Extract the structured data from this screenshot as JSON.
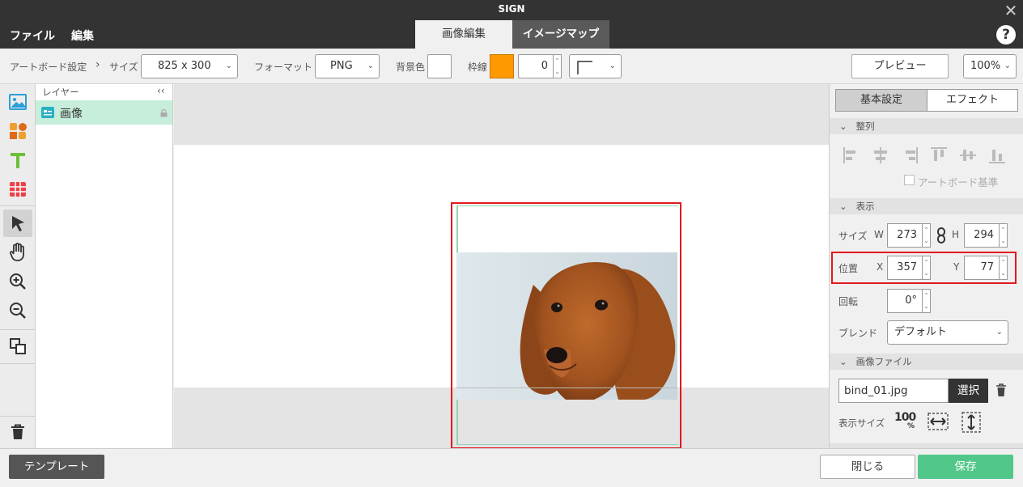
{
  "app": {
    "title": "SIGN",
    "close_glyph": "✕"
  },
  "menu": {
    "file": "ファイル",
    "edit": "編集"
  },
  "tabs": {
    "image_edit": "画像編集",
    "image_map": "イメージマップ"
  },
  "help_glyph": "?",
  "toolbar": {
    "artboard_settings": "アートボード設定",
    "arrow": "›",
    "size_label": "サイズ",
    "size_value": "825 x 300",
    "format_label": "フォーマット",
    "format_value": "PNG",
    "bg_color_label": "背景色",
    "bg_color": "#ffffff",
    "border_label": "枠線",
    "border_color": "#ff9900",
    "border_width": "0",
    "preview_button": "プレビュー",
    "zoom_value": "100%"
  },
  "layers": {
    "header": "レイヤー",
    "collapse_glyph": "‹‹",
    "items": [
      {
        "label": "画像"
      }
    ]
  },
  "right": {
    "tabs": {
      "basic": "基本設定",
      "effect": "エフェクト"
    },
    "align": {
      "header": "整列",
      "artboard_basis": "アートボード基準"
    },
    "display": {
      "header": "表示",
      "size_label": "サイズ",
      "w_label": "W",
      "w_value": "273",
      "h_label": "H",
      "h_value": "294",
      "position_label": "位置",
      "x_label": "X",
      "x_value": "357",
      "y_label": "Y",
      "y_value": "77",
      "rotation_label": "回転",
      "rotation_value": "0°",
      "blend_label": "ブレンド",
      "blend_value": "デフォルト"
    },
    "image_file": {
      "header": "画像ファイル",
      "filename": "bind_01.jpg",
      "select_button": "選択",
      "display_size_label": "表示サイズ",
      "size_100": "100",
      "size_pct": "%"
    }
  },
  "bottom": {
    "template_button": "テンプレート",
    "close_button": "閉じる",
    "save_button": "保存"
  },
  "colors": {
    "accent_green": "#52c78a",
    "selection_red": "#e0191e",
    "dark": "#333333",
    "layer_selected": "#c6eedb"
  },
  "icons": [
    "image-icon",
    "shapes-icon",
    "text-icon",
    "table-icon",
    "pointer-icon",
    "hand-icon",
    "zoom-in-icon",
    "zoom-out-icon",
    "arrange-icon",
    "trash-icon",
    "lock-icon",
    "link-icon"
  ]
}
